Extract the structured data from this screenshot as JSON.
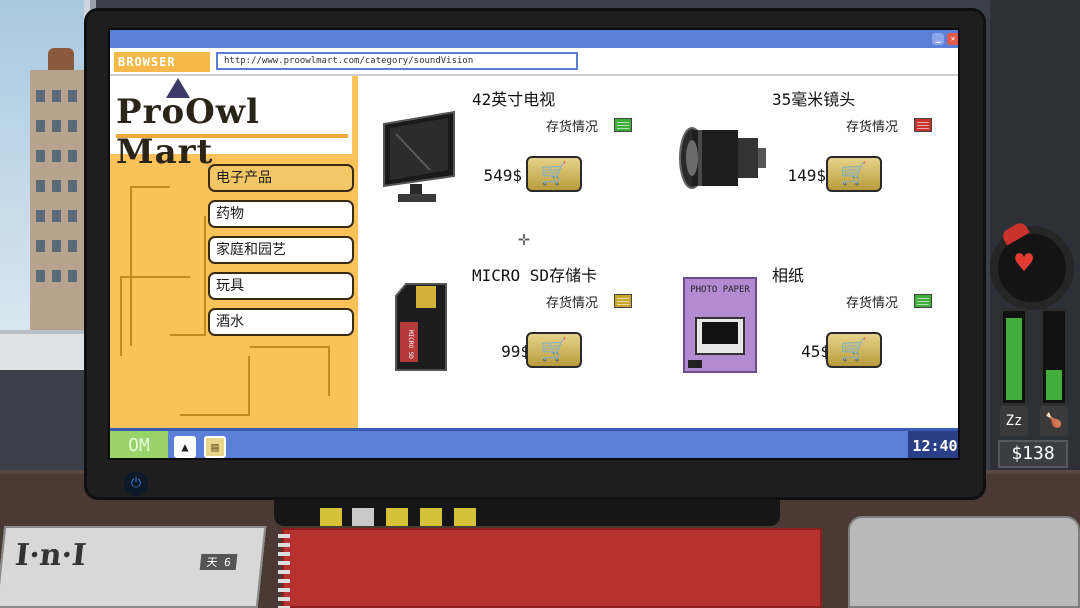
{
  "browser": {
    "logo": "BROWSER",
    "url": "http://www.proowlmart.com/category/soundVision"
  },
  "store": {
    "name": "ProOwl Mart"
  },
  "categories": [
    {
      "label": "电子产品",
      "active": true
    },
    {
      "label": "药物",
      "active": false
    },
    {
      "label": "家庭和园艺",
      "active": false
    },
    {
      "label": "玩具",
      "active": false
    },
    {
      "label": "酒水",
      "active": false
    }
  ],
  "products": [
    {
      "name": "42英寸电视",
      "stock_label": "存货情况",
      "stock_color": "#3fae3a",
      "price": "549$",
      "icon": "tv-icon"
    },
    {
      "name": "35毫米镜头",
      "stock_label": "存货情况",
      "stock_color": "#c9332c",
      "price": "149$",
      "icon": "camera-lens-icon"
    },
    {
      "name": "MICRO SD存储卡",
      "stock_label": "存货情况",
      "stock_color": "#c9a62c",
      "price": "99$",
      "icon": "sd-card-icon",
      "card_text": "MICRO SD"
    },
    {
      "name": "相纸",
      "stock_label": "存货情况",
      "stock_color": "#3fae3a",
      "price": "45$",
      "icon": "photo-paper-icon",
      "card_text": "PHOTO PAPER"
    }
  ],
  "taskbar": {
    "start_label": "OM",
    "clock": "12:40"
  },
  "hud": {
    "money": "$138",
    "energy_level": 0.95,
    "hunger_level": 0.35
  },
  "newspaper": {
    "logo": "I·n·I",
    "day": "天 6"
  },
  "colors": {
    "accent": "#5b7fd6",
    "sidebar": "#fcc25a",
    "cart_button": "#d4bd62"
  }
}
